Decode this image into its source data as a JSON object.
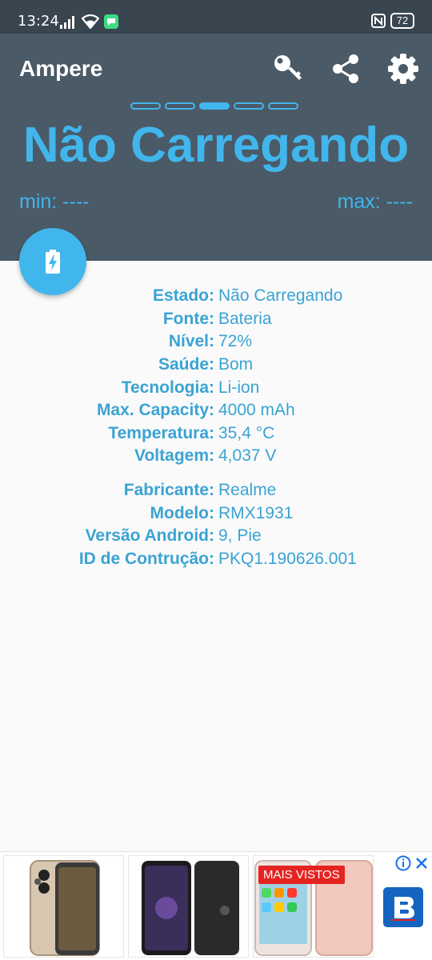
{
  "status_bar": {
    "time": "13:24",
    "battery": "72"
  },
  "app": {
    "title": "Ampere"
  },
  "header": {
    "pages": 5,
    "active_page": 3,
    "status": "Não Carregando",
    "min": "min: ----",
    "max": "max: ----"
  },
  "info": [
    {
      "label": "Estado:",
      "value": "Não Carregando"
    },
    {
      "label": "Fonte:",
      "value": "Bateria"
    },
    {
      "label": "Nível:",
      "value": "72%"
    },
    {
      "label": "Saúde:",
      "value": "Bom"
    },
    {
      "label": "Tecnologia:",
      "value": "Li-ion"
    },
    {
      "label": "Max. Capacity:",
      "value": "4000 mAh"
    },
    {
      "label": "Temperatura:",
      "value": "35,4 °C"
    },
    {
      "label": "Voltagem:",
      "value": "4,037 V"
    },
    {
      "label": "Fabricante:",
      "value": "Realme"
    },
    {
      "label": "Modelo:",
      "value": "RMX1931"
    },
    {
      "label": "Versão Android:",
      "value": "9, Pie"
    },
    {
      "label": "ID de Contrução:",
      "value": "PKQ1.190626.001"
    }
  ],
  "ad": {
    "badge": "MAIS VISTOS"
  },
  "colors": {
    "header": "#4b5a67",
    "status_bar": "#39454f",
    "accent": "#41b6ec",
    "text": "#3aa3d4",
    "ad_badge": "#e52421",
    "ad_logo": "#1565c0"
  },
  "icons": [
    "signal-icon",
    "wifi-icon",
    "message-icon",
    "nfc-icon",
    "battery-icon",
    "key-icon",
    "share-icon",
    "gear-icon",
    "battery-charging-icon",
    "info-icon",
    "close-icon"
  ]
}
